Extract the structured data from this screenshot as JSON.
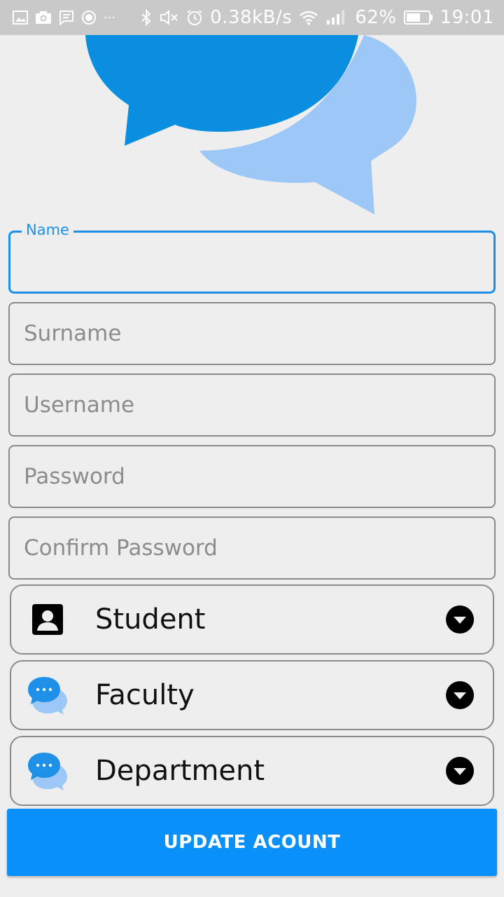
{
  "status_bar": {
    "net_speed": "0.38kB/s",
    "battery_percent": "62%",
    "time": "19:01",
    "battery_level": 0.62,
    "left_icons": [
      "image-icon",
      "camera-icon",
      "message-icon",
      "record-icon",
      "more-icon"
    ],
    "right_icons": [
      "bluetooth-icon",
      "mute-icon",
      "alarm-icon",
      "wifi-icon",
      "signal-icon",
      "battery-icon"
    ]
  },
  "logo": {
    "icon": "chat-bubbles-logo",
    "colors": {
      "primary": "#0a8fe0",
      "secondary": "#9cc7f7"
    }
  },
  "form": {
    "name": {
      "label": "Name",
      "value": "",
      "placeholder": ""
    },
    "surname": {
      "placeholder": "Surname",
      "value": ""
    },
    "username": {
      "placeholder": "Username",
      "value": ""
    },
    "password": {
      "placeholder": "Password",
      "value": ""
    },
    "confirm_password": {
      "placeholder": "Confirm Password",
      "value": ""
    }
  },
  "spinners": [
    {
      "label": "Student",
      "icon": "account-box-icon"
    },
    {
      "label": "Faculty",
      "icon": "chat-bubbles-icon"
    },
    {
      "label": "Department",
      "icon": "chat-bubbles-icon"
    }
  ],
  "update_button": {
    "label": "UPDATE ACOUNT"
  },
  "colors": {
    "accent": "#1e8fe8",
    "button": "#0a90fb",
    "background": "#eeeeee",
    "status_bar": "#c9c9c9"
  }
}
